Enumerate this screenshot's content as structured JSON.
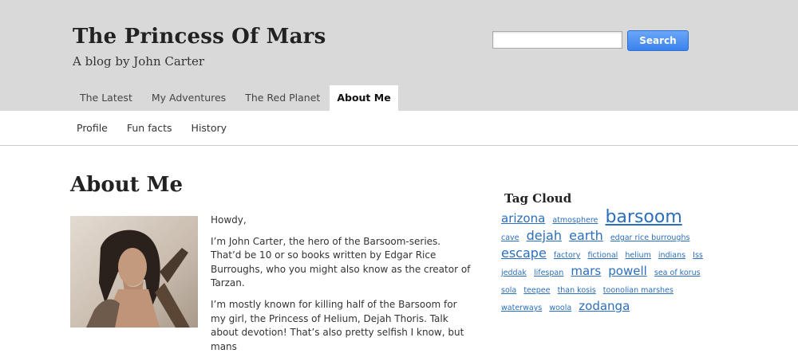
{
  "header": {
    "site_title": "The Princess Of Mars",
    "tagline": "A blog by John Carter",
    "search": {
      "value": "",
      "placeholder": "",
      "button_label": "Search"
    }
  },
  "main_nav": {
    "tabs": [
      {
        "label": "The Latest",
        "active": false
      },
      {
        "label": "My Adventures",
        "active": false
      },
      {
        "label": "The Red Planet",
        "active": false
      },
      {
        "label": "About Me",
        "active": true
      }
    ]
  },
  "sub_nav": {
    "items": [
      {
        "label": "Profile"
      },
      {
        "label": "Fun facts"
      },
      {
        "label": "History"
      }
    ]
  },
  "content": {
    "heading": "About Me",
    "paragraphs": [
      "Howdy,",
      "I’m John Carter, the hero of the Barsoom-series. That’d be 10 or so books written by Edgar Rice Burroughs, who you might also know as the creator of Tarzan.",
      "I’m mostly known for killing half of the Barsoom for my girl, the Princess of Helium, Dejah Thoris. Talk about devotion! That’s also pretty selfish I know, but mans"
    ]
  },
  "sidebar": {
    "heading": "Tag Cloud",
    "tags": [
      {
        "label": "arizona",
        "size": 15
      },
      {
        "label": "atmosphere",
        "size": 9.5
      },
      {
        "label": "barsoom",
        "size": 22
      },
      {
        "label": "cave",
        "size": 9.5
      },
      {
        "label": "dejah",
        "size": 16
      },
      {
        "label": "earth",
        "size": 16
      },
      {
        "label": "edgar rice burroughs",
        "size": 9.5
      },
      {
        "label": "escape",
        "size": 16
      },
      {
        "label": "factory",
        "size": 9.5
      },
      {
        "label": "fictional",
        "size": 9.5
      },
      {
        "label": "helium",
        "size": 9.5
      },
      {
        "label": "indians",
        "size": 9.5
      },
      {
        "label": "Iss",
        "size": 9.5
      },
      {
        "label": "jeddak",
        "size": 9.5
      },
      {
        "label": "lifespan",
        "size": 9.5
      },
      {
        "label": "mars",
        "size": 15
      },
      {
        "label": "powell",
        "size": 15
      },
      {
        "label": "sea of korus",
        "size": 9.5
      },
      {
        "label": "sola",
        "size": 9.5
      },
      {
        "label": "teepee",
        "size": 9.5
      },
      {
        "label": "than kosis",
        "size": 9.5
      },
      {
        "label": "toonolian marshes",
        "size": 9.5
      },
      {
        "label": "waterways",
        "size": 9.5
      },
      {
        "label": "woola",
        "size": 9.5
      },
      {
        "label": "zodanga",
        "size": 15
      }
    ]
  },
  "colors": {
    "header_bg": "#d9d9d9",
    "link": "#2a6ebd",
    "search_button": "#3b82ee"
  }
}
